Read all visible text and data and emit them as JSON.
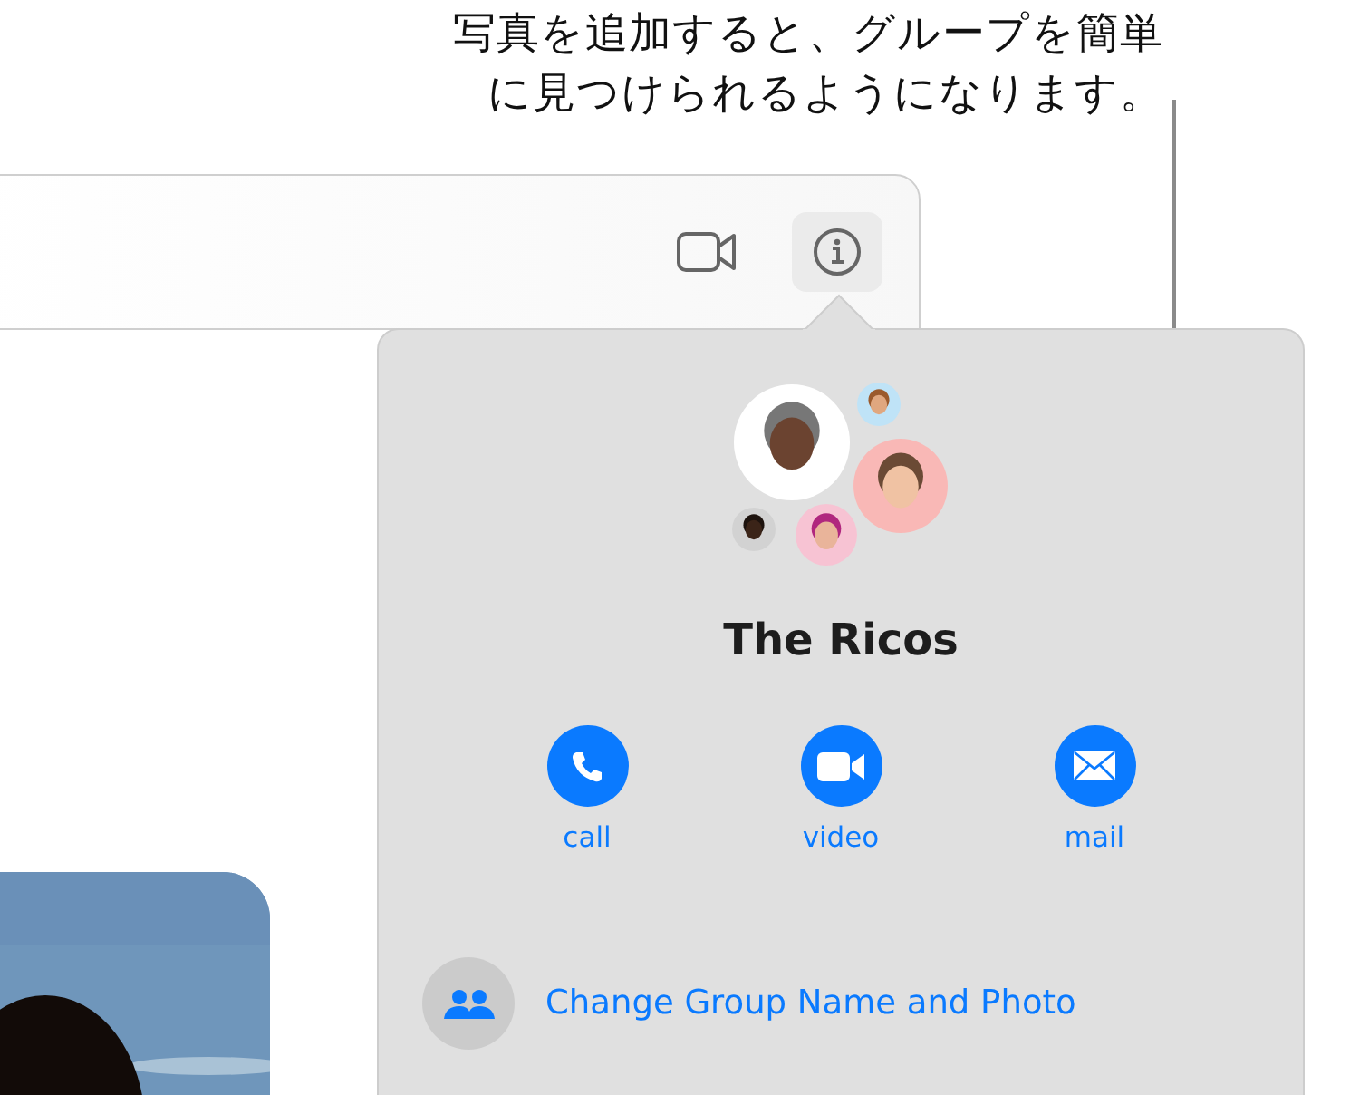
{
  "callout": {
    "text": "写真を追加すると、グループを簡単に見つけられるようになります。"
  },
  "toolbar": {
    "buttons": [
      {
        "kind": "video",
        "selected": false
      },
      {
        "kind": "info",
        "selected": true
      }
    ]
  },
  "popover": {
    "group_name": "The Ricos",
    "members": [
      {
        "color": "#ffffff"
      },
      {
        "color": "#bfe3f7"
      },
      {
        "color": "#f9b8b6"
      },
      {
        "color": "#d2d2d2"
      },
      {
        "color": "#f7c3d3"
      }
    ],
    "actions": [
      {
        "kind": "call",
        "label": "call"
      },
      {
        "kind": "video",
        "label": "video"
      },
      {
        "kind": "mail",
        "label": "mail"
      }
    ],
    "link": {
      "label": "Change Group Name and Photo"
    }
  }
}
